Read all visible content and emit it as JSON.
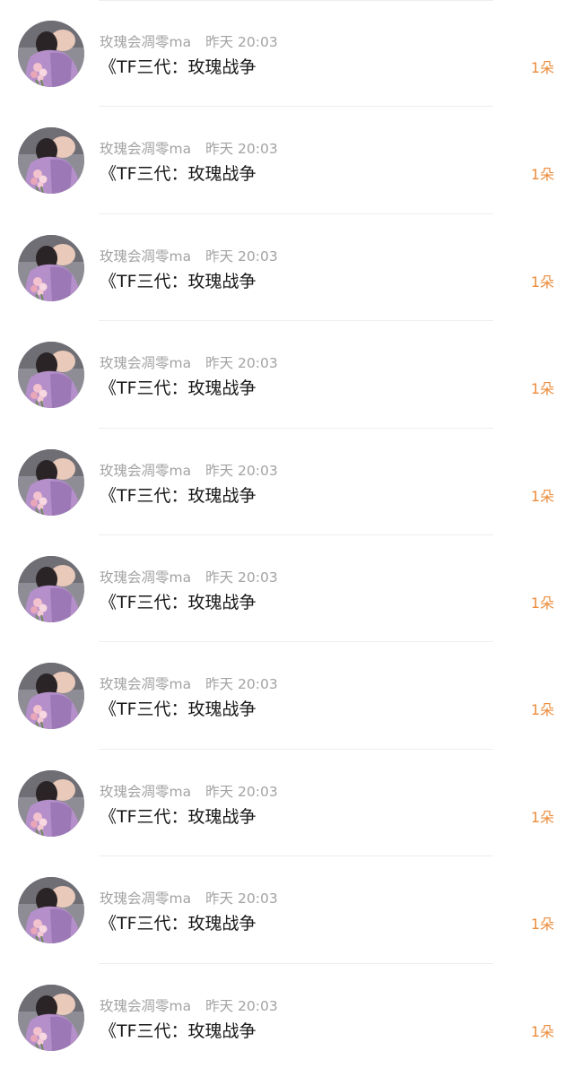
{
  "items": [
    {
      "username": "玫瑰会凋零ma",
      "time": "昨天 20:03",
      "title": "《TF三代：玫瑰战争",
      "count": "1朵"
    },
    {
      "username": "玫瑰会凋零ma",
      "time": "昨天 20:03",
      "title": "《TF三代：玫瑰战争",
      "count": "1朵"
    },
    {
      "username": "玫瑰会凋零ma",
      "time": "昨天 20:03",
      "title": "《TF三代：玫瑰战争",
      "count": "1朵"
    },
    {
      "username": "玫瑰会凋零ma",
      "time": "昨天 20:03",
      "title": "《TF三代：玫瑰战争",
      "count": "1朵"
    },
    {
      "username": "玫瑰会凋零ma",
      "time": "昨天 20:03",
      "title": "《TF三代：玫瑰战争",
      "count": "1朵"
    },
    {
      "username": "玫瑰会凋零ma",
      "time": "昨天 20:03",
      "title": "《TF三代：玫瑰战争",
      "count": "1朵"
    },
    {
      "username": "玫瑰会凋零ma",
      "time": "昨天 20:03",
      "title": "《TF三代：玫瑰战争",
      "count": "1朵"
    },
    {
      "username": "玫瑰会凋零ma",
      "time": "昨天 20:03",
      "title": "《TF三代：玫瑰战争",
      "count": "1朵"
    },
    {
      "username": "玫瑰会凋零ma",
      "time": "昨天 20:03",
      "title": "《TF三代：玫瑰战争",
      "count": "1朵"
    },
    {
      "username": "玫瑰会凋零ma",
      "time": "昨天 20:03",
      "title": "《TF三代：玫瑰战争",
      "count": "1朵"
    }
  ],
  "colors": {
    "username": "#a3a3a3",
    "time": "#a3a3a3",
    "title": "#1a1a1a",
    "count": "#ec8c3c",
    "divider": "#ededed"
  }
}
